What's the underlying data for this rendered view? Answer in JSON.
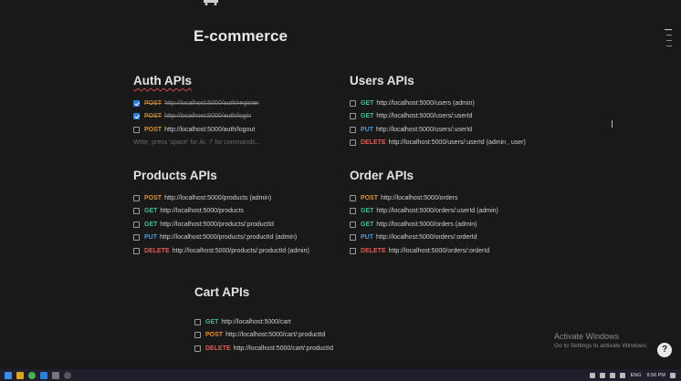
{
  "page": {
    "title": "E-commerce"
  },
  "sections": {
    "auth": {
      "heading": "Auth APIs",
      "items": [
        {
          "method": "POST",
          "url": "http://localhost:5000/auth/register",
          "checked": true
        },
        {
          "method": "POST",
          "url": "http://localhost:5000/auth/login",
          "checked": true
        },
        {
          "method": "POST",
          "url": "http://localhost:5000/auth/logout",
          "checked": false
        }
      ],
      "placeholder": "Write, press 'space' for AI, '/' for commands..."
    },
    "users": {
      "heading": "Users APIs",
      "items": [
        {
          "method": "GET",
          "url": "http://localhost:5000/users (admin)",
          "checked": false
        },
        {
          "method": "GET",
          "url": "http://localhost:5000/users/:userId",
          "checked": false
        },
        {
          "method": "PUT",
          "url": "http://localhost:5000/users/:userId",
          "checked": false
        },
        {
          "method": "DELETE",
          "url": "http://localhost:5000/users/:userId (admin , user)",
          "checked": false
        }
      ]
    },
    "products": {
      "heading": "Products APIs",
      "items": [
        {
          "method": "POST",
          "url": "http://localhost:5000/products (admin)",
          "checked": false
        },
        {
          "method": "GET",
          "url": "http://localhost:5000/products",
          "checked": false
        },
        {
          "method": "GET",
          "url": "http://localhost:5000/products/:productId",
          "checked": false
        },
        {
          "method": "PUT",
          "url": "http://localhost:5000/products/:productId (admin)",
          "checked": false
        },
        {
          "method": "DELETE",
          "url": "http://localhost:5000/products/:productId (admin)",
          "checked": false
        }
      ]
    },
    "orders": {
      "heading": "Order APIs",
      "items": [
        {
          "method": "POST",
          "url": "http://localhost:5000/orders",
          "checked": false
        },
        {
          "method": "GET",
          "url": "http://localhost:5000/orders/:userId (admin)",
          "checked": false
        },
        {
          "method": "GET",
          "url": "http://localhost:5000/orders (admin)",
          "checked": false
        },
        {
          "method": "PUT",
          "url": "http://localhost:5000/orders/:orderId",
          "checked": false
        },
        {
          "method": "DELETE",
          "url": "http://localhost:5000/orders/:orderId",
          "checked": false
        }
      ]
    },
    "cart": {
      "heading": "Cart APIs",
      "items": [
        {
          "method": "GET",
          "url": "http://localhost:5000/cart",
          "checked": false
        },
        {
          "method": "POST",
          "url": "http://localhost:5000/cart/:productId",
          "checked": false
        },
        {
          "method": "DELETE",
          "url": "http://localhost:5000/cart/:productId",
          "checked": false
        }
      ]
    }
  },
  "watermark": {
    "title": "Activate Windows",
    "subtitle": "Go to Settings to activate Windows."
  },
  "help": {
    "label": "?"
  },
  "taskbar": {
    "language": "ENG",
    "time": "8:56 PM"
  },
  "colors": {
    "background": "#191919",
    "POST": "#e0903a",
    "GET": "#4bb89e",
    "PUT": "#4a9be8",
    "DELETE": "#e25a4f",
    "checked": "#2f7fd6"
  }
}
